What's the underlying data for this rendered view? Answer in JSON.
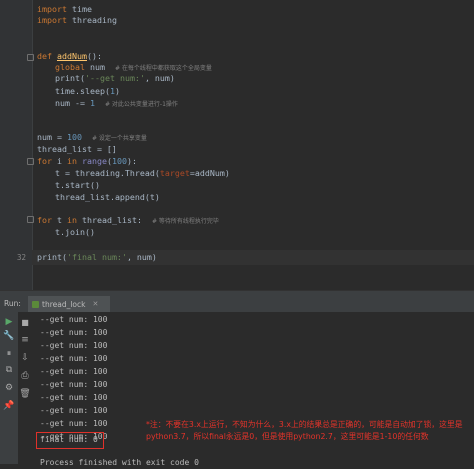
{
  "editor": {
    "lines": {
      "l1": {
        "kw": "import",
        "rest": " time"
      },
      "l2": {
        "kw": "import",
        "rest": " threading"
      },
      "l3": {
        "kw": "def",
        "name": "addNum",
        "rest": "():"
      },
      "l4": {
        "kw": "global",
        "rest": " num",
        "comment": "# 在每个线程中都获取这个全局变量"
      },
      "l5": {
        "a": "print(",
        "s": "'--get num:'",
        "b": ", num)"
      },
      "l6": {
        "text": "time.sleep(",
        "n": "1",
        "close": ")"
      },
      "l7": {
        "text": "num -= ",
        "n": "1",
        "comment": "# 对此公共变量进行-1操作"
      },
      "l8": {
        "text": "num = ",
        "n": "100",
        "comment": "# 设定一个共享变量"
      },
      "l9": {
        "text": "thread_list = []"
      },
      "l10": {
        "kw": "for",
        "a": " i ",
        "kw2": "in",
        "b": " ",
        "bi": "range",
        "c": "(",
        "n": "100",
        "d": "):"
      },
      "l11": {
        "a": "t = threading.Thread(",
        "param": "target",
        "b": "=addNum)"
      },
      "l12": {
        "text": "t.start()"
      },
      "l13": {
        "text": "thread_list.append(t)"
      },
      "l14": {
        "kw": "for",
        "a": " t ",
        "kw2": "in",
        "b": " thread_list:",
        "comment": "# 等待所有线程执行完毕"
      },
      "l15": {
        "text": "t.join()"
      },
      "l16": {
        "a": "print(",
        "s": "'final num:'",
        "b": ", num)"
      }
    },
    "current_line_number": "32"
  },
  "run_panel": {
    "run_label": "Run:",
    "tab_label": "thread_lock",
    "console_lines": [
      "--get num: 100",
      "--get num: 100",
      "--get num: 100",
      "--get num: 100",
      "--get num: 100",
      "--get num: 100",
      "--get num: 100",
      "--get num: 100",
      "--get num: 100",
      "--get num: 100"
    ],
    "final_line": "final num: 0",
    "exit_line": "Process finished with exit code 0"
  },
  "annotation": {
    "text": "*注：不要在3.x上运行，不知为什么，3.x上的结果总是正确的，可能是自动加了锁，这里是python3.7，所以final永远是0，但是使用python2.7，这里可能是1-10的任何数"
  },
  "colors": {
    "keyword": "#cc7832",
    "function": "#ffc66d",
    "number": "#6897bb",
    "string": "#6a8759",
    "comment": "#808080",
    "annotation": "#e5332a"
  }
}
